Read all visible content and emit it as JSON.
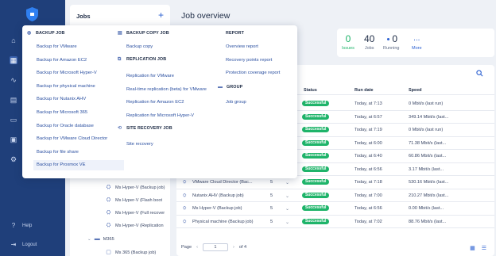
{
  "rail": {
    "bottom": [
      {
        "label": "Help",
        "icon": "help-icon"
      },
      {
        "label": "Logout",
        "icon": "logout-icon"
      }
    ]
  },
  "jobs_panel": {
    "title": "Jobs",
    "add_icon": "plus-icon",
    "tree": [
      {
        "label": "Ms Hyper-V (Backup job)"
      },
      {
        "label": "Ms Hyper-V (Flash boot"
      },
      {
        "label": "Ms Hyper-V (Full recover"
      },
      {
        "label": "Ms Hyper-V (Replication"
      }
    ],
    "group": {
      "label": "M365"
    },
    "last": {
      "label": "Ms 365 (Backup job)"
    }
  },
  "main": {
    "title": "Job overview",
    "stats": {
      "issues": {
        "value": "0",
        "label": "Issues"
      },
      "jobs": {
        "value": "40",
        "label": "Jobs"
      },
      "running": {
        "value": "0",
        "label": "Running"
      },
      "more": {
        "value": "...",
        "label": "More"
      }
    }
  },
  "table": {
    "headers": {
      "status": "Status",
      "run_date": "Run date",
      "speed": "Speed"
    },
    "rows": [
      {
        "name": "",
        "count": "",
        "status": "Successful",
        "date": "Today, at 7:13",
        "speed": "0 Mbit/s (last run)"
      },
      {
        "name": "",
        "count": "",
        "status": "Successful",
        "date": "Today, at 6:57",
        "speed": "349.14 Mbit/s (last..."
      },
      {
        "name": "",
        "count": "",
        "status": "Successful",
        "date": "Today, at 7:19",
        "speed": "0 Mbit/s (last run)"
      },
      {
        "name": "",
        "count": "",
        "status": "Successful",
        "date": "Today, at 6:00",
        "speed": "71.38 Mbit/s (last..."
      },
      {
        "name": "",
        "count": "",
        "status": "Successful",
        "date": "Today, at 6:40",
        "speed": "60.86 Mbit/s (last..."
      },
      {
        "name": "",
        "count": "",
        "status": "Successful",
        "date": "Today, at 6:56",
        "speed": "3.17 Mbit/s (last..."
      },
      {
        "name": "VMware Cloud Director (Bac...",
        "count": "5",
        "status": "Successful",
        "date": "Today, at 7:18",
        "speed": "530.16 Mbit/s (last..."
      },
      {
        "name": "Nutanix AHV (Backup job)",
        "count": "5",
        "status": "Successful",
        "date": "Today, at 7:00",
        "speed": "210.27 Mbit/s (last..."
      },
      {
        "name": "Ms Hyper-V (Backup job)",
        "count": "5",
        "status": "Successful",
        "date": "Today, at 6:56",
        "speed": "0.00 Mbit/s (last..."
      },
      {
        "name": "Physical machine (Backup job)",
        "count": "5",
        "status": "Successful",
        "date": "Today, at 7:02",
        "speed": "88.76 Mbit/s (last..."
      }
    ],
    "pager": {
      "label": "Page",
      "current": "1",
      "of": "of 4"
    }
  },
  "dropdown": {
    "backup_job": {
      "heading": "BACKUP JOB",
      "items": [
        "Backup for VMware",
        "Backup for Amazon EC2",
        "Backup for Microsoft Hyper-V",
        "Backup for physical machine",
        "Backup for Nutanix AHV",
        "Backup for Microsoft 365",
        "Backup for Oracle database",
        "Backup for VMware Cloud Director",
        "Backup for file share",
        "Backup for Proxmox VE"
      ]
    },
    "backup_copy_job": {
      "heading": "BACKUP COPY JOB",
      "items": [
        "Backup copy"
      ]
    },
    "replication_job": {
      "heading": "REPLICATION JOB",
      "items": [
        "Replication for VMware",
        "Real-time replication (beta) for VMware",
        "Replication for Amazon EC2",
        "Replication for Microsoft Hyper-V"
      ]
    },
    "site_recovery_job": {
      "heading": "SITE RECOVERY JOB",
      "items": [
        "Site recovery"
      ]
    },
    "report": {
      "heading": "REPORT",
      "items": [
        "Overview report",
        "Recovery points report",
        "Protection coverage report"
      ]
    },
    "group": {
      "heading": "GROUP",
      "items": [
        "Job group"
      ]
    }
  },
  "colors": {
    "rail": "#1f3f7a",
    "accent": "#2a5fd1",
    "success": "#1fb46a"
  }
}
